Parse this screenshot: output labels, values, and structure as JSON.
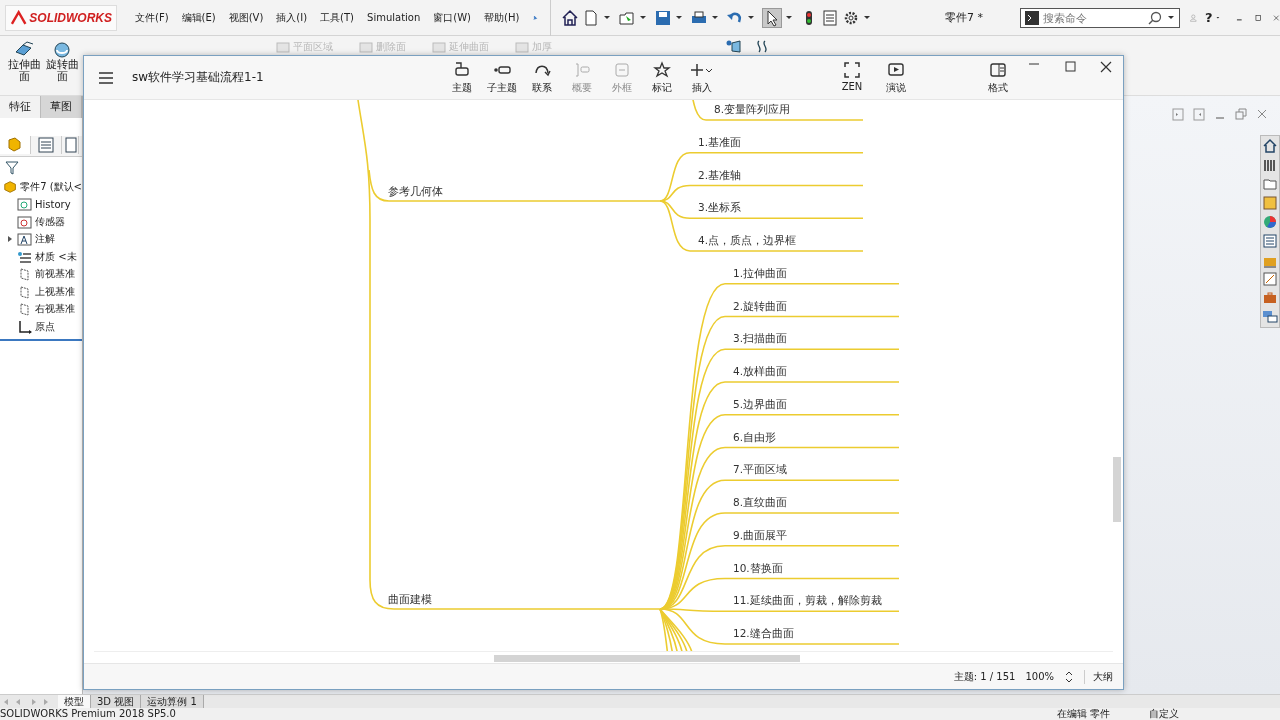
{
  "app": {
    "logo": "SOLIDWORKS",
    "menu": [
      "文件(F)",
      "编辑(E)",
      "视图(V)",
      "插入(I)",
      "工具(T)",
      "Simulation",
      "窗口(W)",
      "帮助(H)"
    ],
    "document_title": "零件7 *",
    "search": {
      "placeholder": "搜索命令"
    },
    "help": "?"
  },
  "command_manager": {
    "big_buttons": [
      {
        "label": "拉伸曲面",
        "kind": "extrude"
      },
      {
        "label": "旋转曲面",
        "kind": "revolve"
      }
    ],
    "faded_buttons": [
      "平面区域",
      "删除面",
      "延伸曲面",
      "加厚"
    ]
  },
  "manager_tabs": [
    {
      "label": "特征",
      "selected": true
    },
    {
      "label": "草图",
      "selected": false
    }
  ],
  "feature_tree": {
    "root": "零件7 (默认<",
    "items": [
      {
        "label": "History",
        "kind": "history",
        "expandable": false
      },
      {
        "label": "传感器",
        "kind": "sensor",
        "expandable": false
      },
      {
        "label": "注解",
        "kind": "annotation",
        "expandable": true
      },
      {
        "label": "材质 <未",
        "kind": "material",
        "expandable": false
      },
      {
        "label": "前视基准",
        "kind": "plane",
        "expandable": false
      },
      {
        "label": "上视基准",
        "kind": "plane",
        "expandable": false
      },
      {
        "label": "右视基准",
        "kind": "plane",
        "expandable": false
      },
      {
        "label": "原点",
        "kind": "origin",
        "expandable": false
      }
    ]
  },
  "mind_window": {
    "title": "sw软件学习基础流程1-1",
    "tools": [
      {
        "label": "主题",
        "kind": "topic",
        "disabled": false
      },
      {
        "label": "子主题",
        "kind": "subtopic",
        "disabled": false
      },
      {
        "label": "联系",
        "kind": "relation",
        "disabled": false
      },
      {
        "label": "概要",
        "kind": "summary",
        "disabled": true
      },
      {
        "label": "外框",
        "kind": "boundary",
        "disabled": true
      },
      {
        "label": "标记",
        "kind": "marker",
        "disabled": false
      },
      {
        "label": "插入",
        "kind": "insert",
        "disabled": false
      }
    ],
    "view_tools": [
      {
        "label": "ZEN",
        "kind": "zen"
      },
      {
        "label": "演说",
        "kind": "present"
      }
    ],
    "format": "格式",
    "topics": [
      {
        "children": [
          "8.变量阵列应用"
        ]
      },
      {
        "label": "参考几何体",
        "children": [
          "1.基准面",
          "2.基准轴",
          "3.坐标系",
          "4.点，质点，边界框"
        ]
      },
      {
        "label": "曲面建模",
        "children": [
          "1.拉伸曲面",
          "2.旋转曲面",
          "3.扫描曲面",
          "4.放样曲面",
          "5.边界曲面",
          "6.自由形",
          "7.平面区域",
          "8.直纹曲面",
          "9.曲面展平",
          "10.替换面",
          "11.延续曲面，剪裁，解除剪裁",
          "12.缝合曲面"
        ]
      }
    ],
    "status": {
      "topic_count": "主题: 1 / 151",
      "zoom": "100%",
      "outline": "大纲"
    }
  },
  "bottom_tabs": [
    {
      "label": "模型",
      "selected": true
    },
    {
      "label": "3D 视图",
      "selected": false
    },
    {
      "label": "运动算例 1",
      "selected": false
    }
  ],
  "status_bar": {
    "product": "SOLIDWORKS Premium 2018 SP5.0",
    "mode": "在编辑 零件",
    "units": "自定义"
  }
}
